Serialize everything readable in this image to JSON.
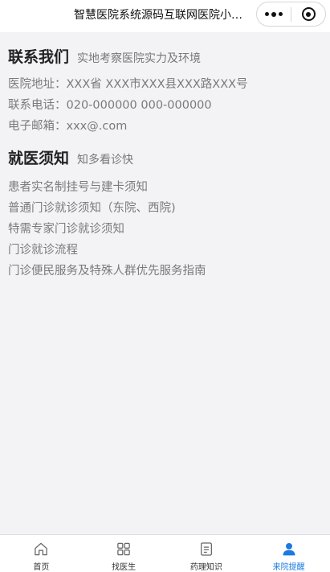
{
  "window": {
    "title": "智慧医院系统源码互联网医院小程序..."
  },
  "contact": {
    "heading": "联系我们",
    "subheading": "实地考察医院实力及环境",
    "address": "医院地址：XXX省 XXX市XXX县XXX路XXX号",
    "phone": "联系电话：020-000000 000-000000",
    "email": "电子邮箱：xxx@.com"
  },
  "guide": {
    "heading": "就医须知",
    "subheading": "知多看诊快",
    "items": [
      "患者实名制挂号与建卡须知",
      "普通门诊就诊须知（东院、西院)",
      "特需专家门诊就诊须知",
      "门诊就诊流程",
      "门诊便民服务及特殊人群优先服务指南"
    ]
  },
  "tabbar": {
    "tabs": [
      {
        "label": "首页",
        "icon": "home-icon"
      },
      {
        "label": "找医生",
        "icon": "grid-icon"
      },
      {
        "label": "药理知识",
        "icon": "document-icon"
      },
      {
        "label": "来院提醒",
        "icon": "user-icon"
      }
    ],
    "active_index": 3,
    "active_color": "#1a7ae0",
    "inactive_color": "#555555"
  }
}
